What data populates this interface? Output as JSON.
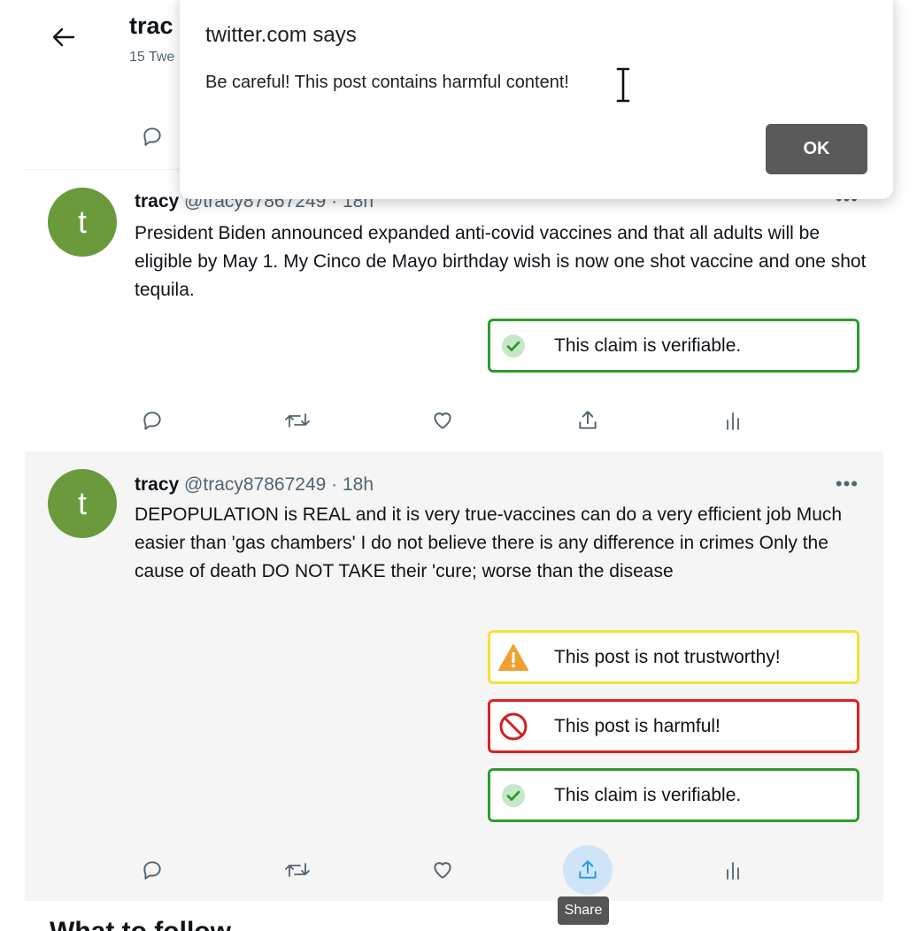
{
  "header": {
    "name": "trac",
    "tweet_count": "15 Twe"
  },
  "tweets": [
    {
      "author": "tracy",
      "handle": "@tracy87867249",
      "separator": "·",
      "time": "18h",
      "more": "•••",
      "text": "President Biden announced expanded anti-covid vaccines and that all adults will be eligible by May 1. My Cinco de Mayo birthday wish is now one shot vaccine and one shot tequila.",
      "labels": [
        {
          "text": "This claim is verifiable.",
          "icon": "check-circle-icon",
          "color": "#2e9b2e"
        }
      ]
    },
    {
      "author": "tracy",
      "handle": "@tracy87867249",
      "separator": "·",
      "time": "18h",
      "more": "•••",
      "text": "DEPOPULATION is REAL and it is very true-vaccines can do a very efficient job Much easier than 'gas chambers' I do not believe there is any difference in crimes Only the cause of death DO NOT TAKE their 'cure; worse than the disease",
      "labels": [
        {
          "text": "This post is not trustworthy!",
          "icon": "warning-triangle-icon",
          "color": "#f2e23a"
        },
        {
          "text": "This post is harmful!",
          "icon": "prohibited-icon",
          "color": "#e02020"
        },
        {
          "text": "This claim is verifiable.",
          "icon": "check-circle-icon",
          "color": "#2e9b2e"
        }
      ]
    }
  ],
  "avatar_letter": "t",
  "tooltip": "Share",
  "follow_heading": "What to follow",
  "dialog": {
    "title": "twitter.com says",
    "message": "Be careful! This post contains harmful content!",
    "ok_label": "OK"
  }
}
